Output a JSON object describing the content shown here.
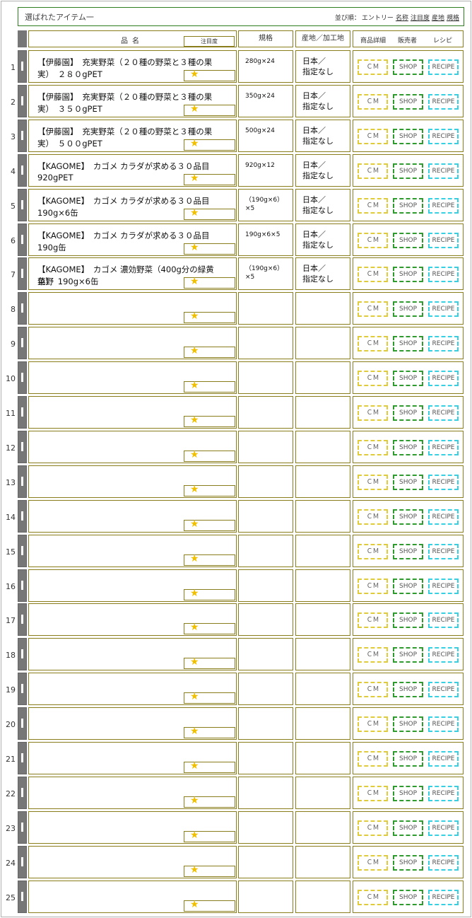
{
  "title": "選ばれたアイテム一",
  "sort": {
    "label": "並び順：",
    "options": [
      "エントリー",
      "名称",
      "注目度",
      "産地",
      "規格"
    ]
  },
  "header": {
    "name": "品名",
    "attention": "注目度",
    "spec": "規格",
    "origin": "産地／加工地",
    "detail": "商品詳細",
    "seller": "販売者",
    "recipe": "レシピ"
  },
  "buttons": {
    "cm": "ＣＭ",
    "shop": "SHOP",
    "recipe": "RECIPE"
  },
  "star_glyph": "★",
  "colors": {
    "title_border": "#2e7d1e",
    "cell_border": "#8a7d1c",
    "star": "#f0c000",
    "cm": "#e0cc3a",
    "shop": "#2f9b2f",
    "recipe": "#37d0e2"
  },
  "rows": [
    {
      "num": "1",
      "name1": "【伊藤園】　充実野菜（２０種の野菜と３種の果",
      "name2": "実）　２８０gPET",
      "spec": "280g×24",
      "origin1": "日本／",
      "origin2": "指定なし"
    },
    {
      "num": "2",
      "name1": "【伊藤園】　充実野菜（２０種の野菜と３種の果",
      "name2": "実）　３５０gPET",
      "spec": "350g×24",
      "origin1": "日本／",
      "origin2": "指定なし"
    },
    {
      "num": "3",
      "name1": "【伊藤園】　充実野菜（２０種の野菜と３種の果",
      "name2": "実）　５００gPET",
      "spec": "500g×24",
      "origin1": "日本／",
      "origin2": "指定なし"
    },
    {
      "num": "4",
      "name1": "【KAGOME】　カゴメ カラダが求める３０品目",
      "name2": "920gPET",
      "spec": "920g×12",
      "origin1": "日本／",
      "origin2": "指定なし"
    },
    {
      "num": "5",
      "name1": "【KAGOME】　カゴメ カラダが求める３０品目",
      "name2": "190g×6缶",
      "spec": "（190g×6）×5",
      "origin1": "日本／",
      "origin2": "指定なし"
    },
    {
      "num": "6",
      "name1": "【KAGOME】　カゴメ カラダが求める３０品目",
      "name2": "190g缶",
      "spec": "190g×6×5",
      "origin1": "日本／",
      "origin2": "指定なし"
    },
    {
      "num": "7",
      "name1": "【KAGOME】　カゴメ 濃効野菜（400g分の緑黄色野",
      "name2": "菜）　190g×6缶",
      "spec": "（190g×6）×5",
      "origin1": "日本／",
      "origin2": "指定なし"
    },
    {
      "num": "8",
      "name1": "",
      "name2": "",
      "spec": "",
      "origin1": "",
      "origin2": ""
    },
    {
      "num": "9",
      "name1": "",
      "name2": "",
      "spec": "",
      "origin1": "",
      "origin2": ""
    },
    {
      "num": "10",
      "name1": "",
      "name2": "",
      "spec": "",
      "origin1": "",
      "origin2": ""
    },
    {
      "num": "11",
      "name1": "",
      "name2": "",
      "spec": "",
      "origin1": "",
      "origin2": ""
    },
    {
      "num": "12",
      "name1": "",
      "name2": "",
      "spec": "",
      "origin1": "",
      "origin2": ""
    },
    {
      "num": "13",
      "name1": "",
      "name2": "",
      "spec": "",
      "origin1": "",
      "origin2": ""
    },
    {
      "num": "14",
      "name1": "",
      "name2": "",
      "spec": "",
      "origin1": "",
      "origin2": ""
    },
    {
      "num": "15",
      "name1": "",
      "name2": "",
      "spec": "",
      "origin1": "",
      "origin2": ""
    },
    {
      "num": "16",
      "name1": "",
      "name2": "",
      "spec": "",
      "origin1": "",
      "origin2": ""
    },
    {
      "num": "17",
      "name1": "",
      "name2": "",
      "spec": "",
      "origin1": "",
      "origin2": ""
    },
    {
      "num": "18",
      "name1": "",
      "name2": "",
      "spec": "",
      "origin1": "",
      "origin2": ""
    },
    {
      "num": "19",
      "name1": "",
      "name2": "",
      "spec": "",
      "origin1": "",
      "origin2": ""
    },
    {
      "num": "20",
      "name1": "",
      "name2": "",
      "spec": "",
      "origin1": "",
      "origin2": ""
    },
    {
      "num": "21",
      "name1": "",
      "name2": "",
      "spec": "",
      "origin1": "",
      "origin2": ""
    },
    {
      "num": "22",
      "name1": "",
      "name2": "",
      "spec": "",
      "origin1": "",
      "origin2": ""
    },
    {
      "num": "23",
      "name1": "",
      "name2": "",
      "spec": "",
      "origin1": "",
      "origin2": ""
    },
    {
      "num": "24",
      "name1": "",
      "name2": "",
      "spec": "",
      "origin1": "",
      "origin2": ""
    },
    {
      "num": "25",
      "name1": "",
      "name2": "",
      "spec": "",
      "origin1": "",
      "origin2": ""
    }
  ]
}
